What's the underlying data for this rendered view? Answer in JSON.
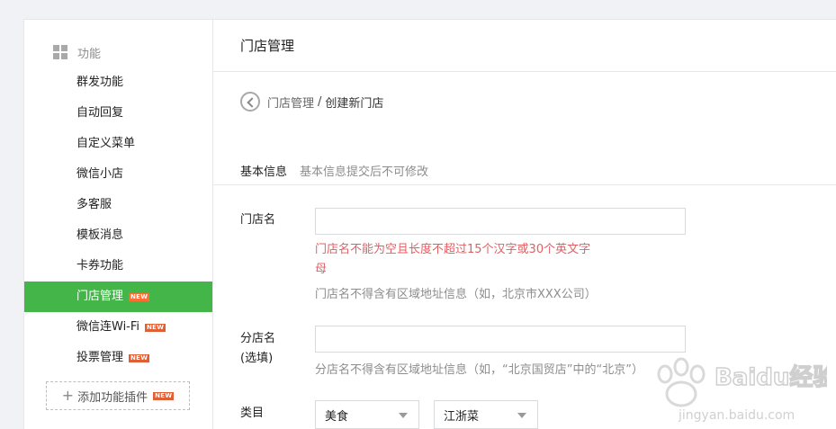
{
  "sidebar": {
    "heading": "功能",
    "items": [
      {
        "label": "群发功能",
        "badge": ""
      },
      {
        "label": "自动回复",
        "badge": ""
      },
      {
        "label": "自定义菜单",
        "badge": ""
      },
      {
        "label": "微信小店",
        "badge": ""
      },
      {
        "label": "多客服",
        "badge": ""
      },
      {
        "label": "模板消息",
        "badge": ""
      },
      {
        "label": "卡券功能",
        "badge": ""
      },
      {
        "label": "门店管理",
        "badge": "NEW"
      },
      {
        "label": "微信连Wi-Fi",
        "badge": "NEW"
      },
      {
        "label": "投票管理",
        "badge": "NEW"
      }
    ],
    "active_index": 7,
    "add_plugin": {
      "label": "添加功能插件",
      "badge": "NEW"
    }
  },
  "main": {
    "title": "门店管理",
    "breadcrumb": {
      "parent": "门店管理",
      "separator": "/",
      "current": "创建新门店"
    },
    "section": {
      "heading": "基本信息",
      "tip": "基本信息提交后不可修改"
    },
    "store_name": {
      "label": "门店名",
      "value": "",
      "error": "门店名不能为空且长度不超过15个汉字或30个英文字母",
      "hint": "门店名不得含有区域地址信息（如，北京市XXX公司）"
    },
    "branch_name": {
      "label": "分店名",
      "label_note": "(选填)",
      "value": "",
      "hint": "分店名不得含有区域地址信息（如，“北京国贸店”中的“北京”）"
    },
    "category": {
      "label": "类目",
      "primary": "美食",
      "secondary": "江浙菜"
    }
  },
  "watermark": {
    "brand": "Baidu经验",
    "url": "jingyan.baidu.com"
  },
  "colors": {
    "accent": "#44b549",
    "error": "#e15f63",
    "badge": "#e15f35"
  }
}
